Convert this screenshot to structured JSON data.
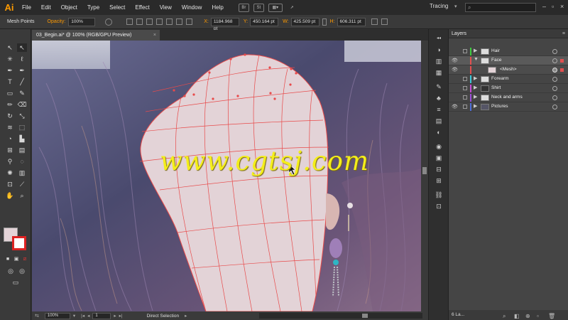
{
  "app": {
    "logo": "Ai"
  },
  "menu": [
    "File",
    "Edit",
    "Object",
    "Type",
    "Select",
    "Effect",
    "View",
    "Window",
    "Help"
  ],
  "menu_icons": [
    "Br",
    "St"
  ],
  "workspace": {
    "label": "Tracing"
  },
  "control": {
    "label": "Mesh Points",
    "opacity_label": "Opacity:",
    "opacity_value": "100%",
    "x_value": "1184.968 pt",
    "y_value": "450.164 pt",
    "w_value": "425.509 pt",
    "h_value": "606.311 pt"
  },
  "document": {
    "tab_title": "03_Begin.ai* @ 100% (RGB/GPU Preview)",
    "close": "×"
  },
  "watermark": "www.cgtsj.com",
  "status": {
    "zoom": "100%",
    "artboard": "1",
    "tool": "Direct Selection"
  },
  "layers_panel": {
    "title": "Layers",
    "footer_count": "6 La...",
    "rows": [
      {
        "name": "Hair",
        "color": "#3ecb3e"
      },
      {
        "name": "Face",
        "color": "#e25050"
      },
      {
        "name": "<Mesh>",
        "color": "#e25050"
      },
      {
        "name": "Forearm",
        "color": "#3ec8d8"
      },
      {
        "name": "Shirt",
        "color": "#c84ed8"
      },
      {
        "name": "Neck and arms",
        "color": "#9b4ed8"
      },
      {
        "name": "Pictures",
        "color": "#4e6ed8"
      }
    ]
  },
  "colors": {
    "accent": "#ff9a00",
    "mesh": "#e84a4a",
    "face_fill": "#e3d3d7",
    "watermark": "#f4ee1a"
  }
}
